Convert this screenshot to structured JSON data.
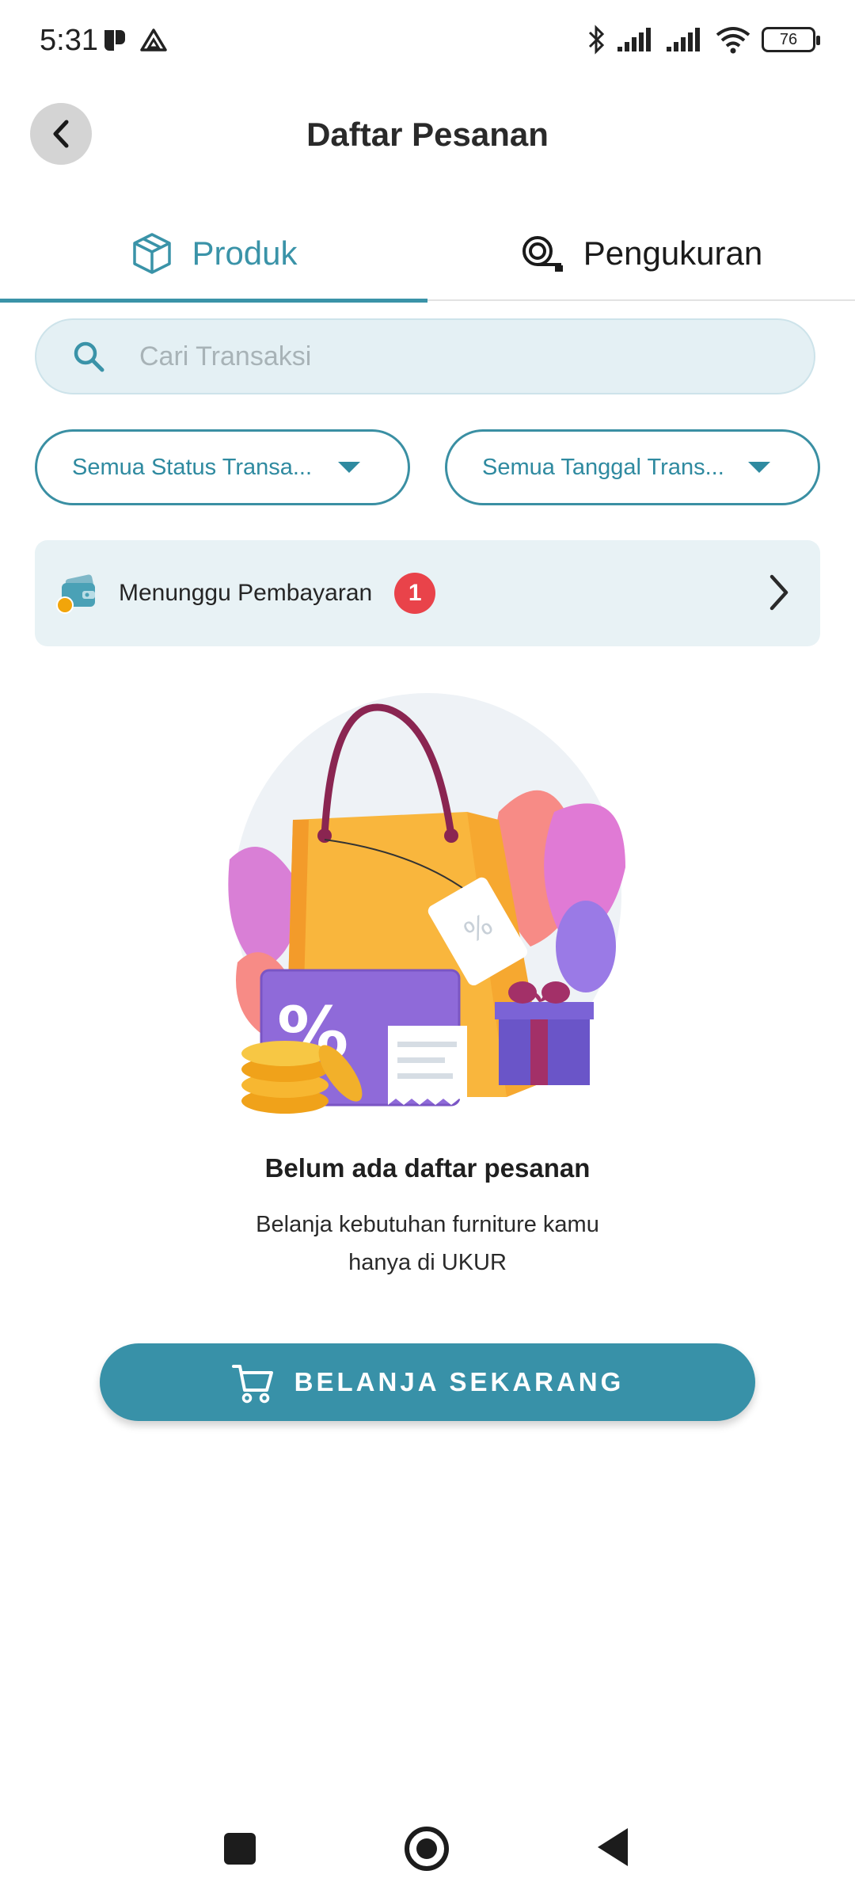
{
  "status_bar": {
    "time": "5:31",
    "battery": "76"
  },
  "header": {
    "title": "Daftar Pesanan"
  },
  "tabs": [
    {
      "label": "Produk",
      "icon": "box-icon",
      "active": true
    },
    {
      "label": "Pengukuran",
      "icon": "measuring-tape-icon",
      "active": false
    }
  ],
  "search": {
    "placeholder": "Cari Transaksi",
    "value": ""
  },
  "filters": {
    "status": "Semua Status Transa...",
    "date": "Semua Tanggal Trans..."
  },
  "waiting_payment": {
    "label": "Menunggu Pembayaran",
    "count": "1"
  },
  "empty_state": {
    "title": "Belum ada daftar pesanan",
    "description": "Belanja kebutuhan furniture kamu hanya di UKUR"
  },
  "cta": {
    "label": "BELANJA SEKARANG"
  },
  "colors": {
    "accent": "#3a93a8",
    "badge": "#e9434a",
    "search_bg": "#e4f0f4"
  }
}
